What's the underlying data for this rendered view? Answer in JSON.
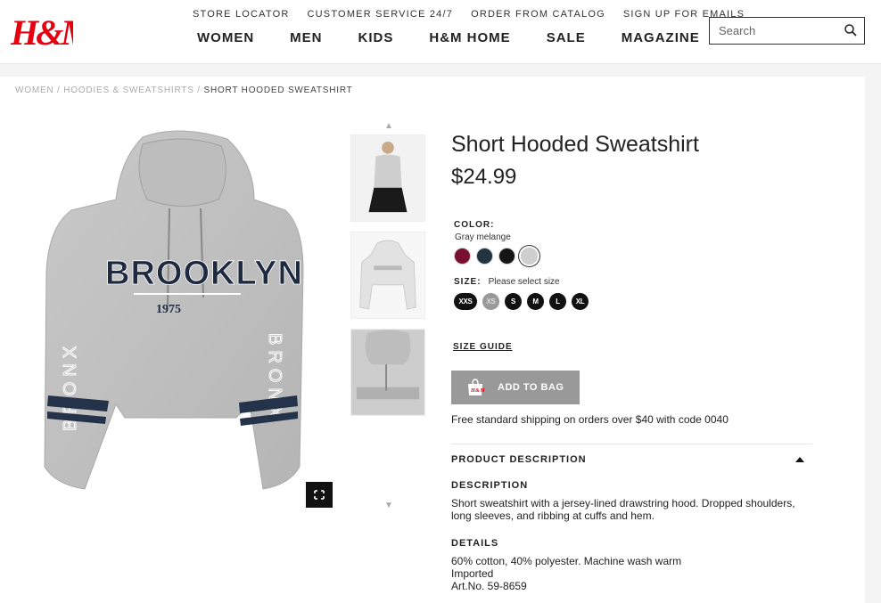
{
  "brand": {
    "logo_text": "H&M",
    "accent": "#e50010"
  },
  "utility_links": [
    "STORE LOCATOR",
    "CUSTOMER SERVICE 24/7",
    "ORDER FROM CATALOG",
    "SIGN UP FOR EMAILS"
  ],
  "main_nav": [
    "WOMEN",
    "MEN",
    "KIDS",
    "H&M HOME",
    "SALE",
    "MAGAZINE"
  ],
  "search": {
    "placeholder": "Search",
    "icon": "search-icon"
  },
  "breadcrumb": {
    "items": [
      "WOMEN",
      "HOODIES & SWEATSHIRTS"
    ],
    "current": "SHORT HOODED SWEATSHIRT",
    "separator": "/"
  },
  "product": {
    "title": "Short Hooded Sweatshirt",
    "price": "$24.99",
    "color_label": "COLOR:",
    "color_name": "Gray melange",
    "swatches": [
      {
        "name": "burgundy",
        "hex": "#7a1030"
      },
      {
        "name": "dark-teal",
        "hex": "#1f3642"
      },
      {
        "name": "black",
        "hex": "#151515"
      },
      {
        "name": "gray-melange",
        "hex": "#cfcfcf",
        "selected": true
      }
    ],
    "size_label": "SIZE:",
    "size_hint": "Please select size",
    "sizes": [
      {
        "label": "XXS",
        "available": true
      },
      {
        "label": "XS",
        "available": false
      },
      {
        "label": "S",
        "available": true
      },
      {
        "label": "M",
        "available": true
      },
      {
        "label": "L",
        "available": true
      },
      {
        "label": "XL",
        "available": true
      }
    ],
    "size_guide": "SIZE GUIDE",
    "add_to_bag": "ADD TO BAG",
    "shipping_note": "Free standard shipping on orders over $40 with code 0040",
    "description_section": "PRODUCT DESCRIPTION",
    "description_label": "DESCRIPTION",
    "description": "Short sweatshirt with a jersey-lined drawstring hood. Dropped shoulders, long sleeves, and ribbing at cuffs and hem.",
    "details_label": "DETAILS",
    "details": [
      "60% cotton, 40% polyester. Machine wash warm",
      "Imported",
      "Art.No. 59-8659"
    ]
  },
  "image": {
    "print_main": "BROOKLYN",
    "print_year": "1975",
    "print_sleeve": "BRONX"
  }
}
